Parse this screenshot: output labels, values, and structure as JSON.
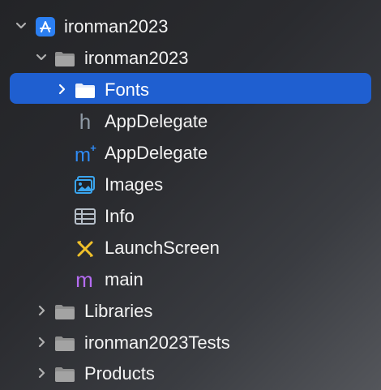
{
  "navigator": {
    "items": [
      {
        "label": "ironman2023",
        "icon": "xcode-project-icon",
        "expanded": true
      },
      {
        "label": "ironman2023",
        "icon": "folder-icon",
        "expanded": true
      },
      {
        "label": "Fonts",
        "icon": "folder-icon",
        "expanded": false,
        "selected": true
      },
      {
        "label": "AppDelegate",
        "icon": "header-file-icon"
      },
      {
        "label": "AppDelegate",
        "icon": "objc-implementation-icon"
      },
      {
        "label": "Images",
        "icon": "asset-catalog-icon"
      },
      {
        "label": "Info",
        "icon": "plist-icon"
      },
      {
        "label": "LaunchScreen",
        "icon": "storyboard-icon"
      },
      {
        "label": "main",
        "icon": "main-file-icon"
      },
      {
        "label": "Libraries",
        "icon": "folder-icon",
        "expanded": false
      },
      {
        "label": "ironman2023Tests",
        "icon": "folder-icon",
        "expanded": false
      },
      {
        "label": "Products",
        "icon": "folder-icon",
        "expanded": false
      }
    ]
  },
  "colors": {
    "selection": "#1f5fd0",
    "project_blue": "#2b7ff2",
    "folder_gray": "#9a9a9a",
    "header_gray": "#8f9aa5",
    "objc_blue": "#2f8bf5",
    "main_purple": "#b56cf2",
    "storyboard_yellow": "#f1c12a"
  }
}
